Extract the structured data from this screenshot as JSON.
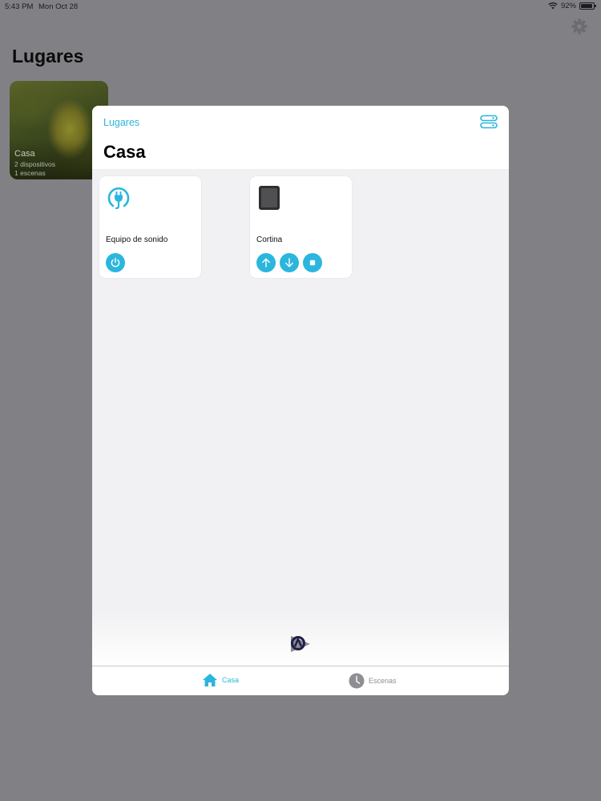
{
  "status_bar": {
    "time": "5:43 PM",
    "date": "Mon Oct 28",
    "battery": "92%",
    "battery_level": 0.92
  },
  "background": {
    "title": "Lugares",
    "place_card": {
      "name": "Casa",
      "devices": "2 dispositivos",
      "scenes": "1 escenas"
    }
  },
  "sheet": {
    "back_label": "Lugares",
    "title": "Casa",
    "devices": [
      {
        "name": "Equipo de sonido",
        "icon": "plug-icon",
        "actions": [
          "power-icon"
        ]
      },
      {
        "name": "Cortina",
        "icon": "tablet-icon",
        "actions": [
          "arrow-up-icon",
          "arrow-down-icon",
          "stop-icon"
        ]
      }
    ]
  },
  "tabbar": {
    "tabs": [
      {
        "label": "Casa",
        "icon": "home-icon",
        "active": true
      },
      {
        "label": "Escenas",
        "icon": "clock-icon",
        "active": false
      }
    ]
  },
  "colors": {
    "accent": "#2bb6dd",
    "dim_background": "#818185",
    "sheet_background": "#f1f1f3"
  }
}
